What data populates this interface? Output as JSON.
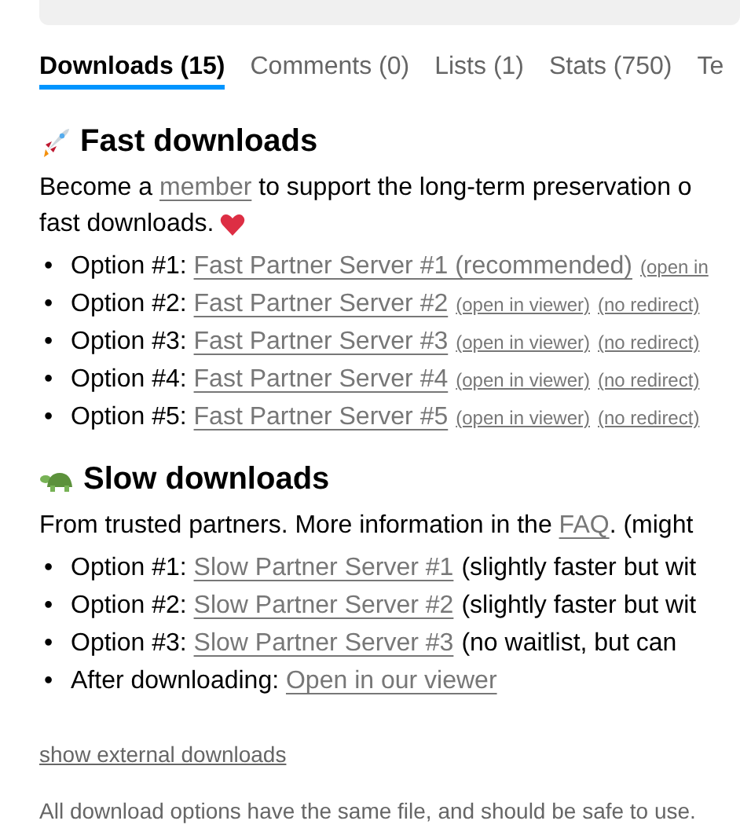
{
  "tabs": [
    {
      "label": "Downloads (15)",
      "selected": true
    },
    {
      "label": "Comments (0)",
      "selected": false
    },
    {
      "label": "Lists (1)",
      "selected": false
    },
    {
      "label": "Stats (750)",
      "selected": false
    },
    {
      "label": "Te",
      "selected": false
    }
  ],
  "fast": {
    "heading": "Fast downloads",
    "intro_before": "Become a ",
    "intro_link": "member",
    "intro_after": " to support the long-term preservation o",
    "intro_line_2": "fast downloads.",
    "options": [
      {
        "marker": "•",
        "label": "Option #1:",
        "link": "Fast Partner Server #1 (recommended)",
        "extras": [
          "(open in"
        ]
      },
      {
        "marker": "•",
        "label": "Option #2:",
        "link": "Fast Partner Server #2",
        "extras": [
          "(open in viewer)",
          "(no redirect)"
        ]
      },
      {
        "marker": "•",
        "label": "Option #3:",
        "link": "Fast Partner Server #3",
        "extras": [
          "(open in viewer)",
          "(no redirect)"
        ]
      },
      {
        "marker": "•",
        "label": "Option #4:",
        "link": "Fast Partner Server #4",
        "extras": [
          "(open in viewer)",
          "(no redirect)"
        ]
      },
      {
        "marker": "•",
        "label": "Option #5:",
        "link": "Fast Partner Server #5",
        "extras": [
          "(open in viewer)",
          "(no redirect)"
        ]
      }
    ]
  },
  "slow": {
    "heading": "Slow downloads",
    "intro_before": "From trusted partners. More information in the ",
    "intro_link": "FAQ",
    "intro_after": ". (might",
    "options": [
      {
        "marker": "•",
        "label": "Option #1:",
        "link": "Slow Partner Server #1",
        "note": "(slightly faster but wit"
      },
      {
        "marker": "•",
        "label": "Option #2:",
        "link": "Slow Partner Server #2",
        "note": "(slightly faster but wit"
      },
      {
        "marker": "•",
        "label": "Option #3:",
        "link": "Slow Partner Server #3",
        "note": "(no waitlist, but can"
      },
      {
        "marker": "•",
        "label": "After downloading:",
        "link": "Open in our viewer"
      }
    ]
  },
  "show_external": "show external downloads",
  "footer": "All download options have the same file, and should be safe to use."
}
